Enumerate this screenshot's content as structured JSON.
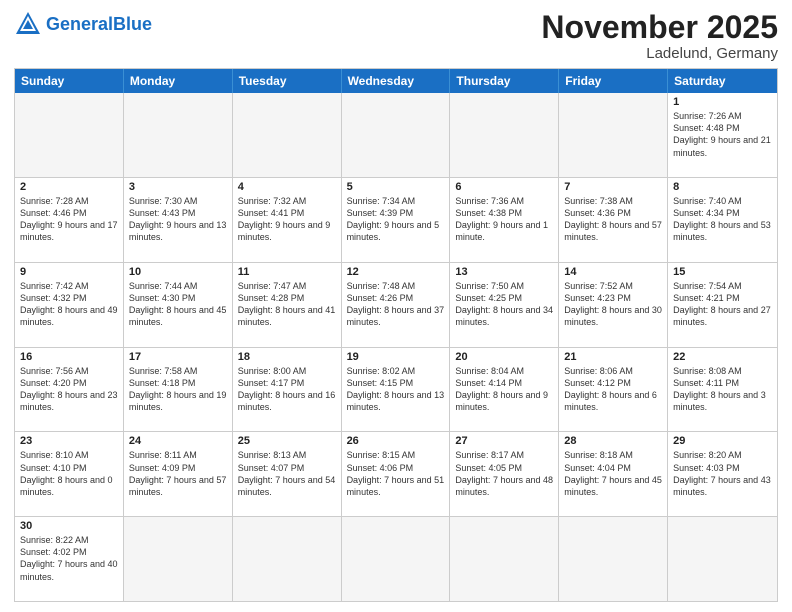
{
  "header": {
    "logo_general": "General",
    "logo_blue": "Blue",
    "month": "November 2025",
    "location": "Ladelund, Germany"
  },
  "days": [
    "Sunday",
    "Monday",
    "Tuesday",
    "Wednesday",
    "Thursday",
    "Friday",
    "Saturday"
  ],
  "rows": [
    [
      {
        "num": "",
        "empty": true
      },
      {
        "num": "",
        "empty": true
      },
      {
        "num": "",
        "empty": true
      },
      {
        "num": "",
        "empty": true
      },
      {
        "num": "",
        "empty": true
      },
      {
        "num": "",
        "empty": true
      },
      {
        "num": "1",
        "sunrise": "Sunrise: 7:26 AM",
        "sunset": "Sunset: 4:48 PM",
        "daylight": "Daylight: 9 hours and 21 minutes."
      }
    ],
    [
      {
        "num": "2",
        "sunrise": "Sunrise: 7:28 AM",
        "sunset": "Sunset: 4:46 PM",
        "daylight": "Daylight: 9 hours and 17 minutes."
      },
      {
        "num": "3",
        "sunrise": "Sunrise: 7:30 AM",
        "sunset": "Sunset: 4:43 PM",
        "daylight": "Daylight: 9 hours and 13 minutes."
      },
      {
        "num": "4",
        "sunrise": "Sunrise: 7:32 AM",
        "sunset": "Sunset: 4:41 PM",
        "daylight": "Daylight: 9 hours and 9 minutes."
      },
      {
        "num": "5",
        "sunrise": "Sunrise: 7:34 AM",
        "sunset": "Sunset: 4:39 PM",
        "daylight": "Daylight: 9 hours and 5 minutes."
      },
      {
        "num": "6",
        "sunrise": "Sunrise: 7:36 AM",
        "sunset": "Sunset: 4:38 PM",
        "daylight": "Daylight: 9 hours and 1 minute."
      },
      {
        "num": "7",
        "sunrise": "Sunrise: 7:38 AM",
        "sunset": "Sunset: 4:36 PM",
        "daylight": "Daylight: 8 hours and 57 minutes."
      },
      {
        "num": "8",
        "sunrise": "Sunrise: 7:40 AM",
        "sunset": "Sunset: 4:34 PM",
        "daylight": "Daylight: 8 hours and 53 minutes."
      }
    ],
    [
      {
        "num": "9",
        "sunrise": "Sunrise: 7:42 AM",
        "sunset": "Sunset: 4:32 PM",
        "daylight": "Daylight: 8 hours and 49 minutes."
      },
      {
        "num": "10",
        "sunrise": "Sunrise: 7:44 AM",
        "sunset": "Sunset: 4:30 PM",
        "daylight": "Daylight: 8 hours and 45 minutes."
      },
      {
        "num": "11",
        "sunrise": "Sunrise: 7:47 AM",
        "sunset": "Sunset: 4:28 PM",
        "daylight": "Daylight: 8 hours and 41 minutes."
      },
      {
        "num": "12",
        "sunrise": "Sunrise: 7:48 AM",
        "sunset": "Sunset: 4:26 PM",
        "daylight": "Daylight: 8 hours and 37 minutes."
      },
      {
        "num": "13",
        "sunrise": "Sunrise: 7:50 AM",
        "sunset": "Sunset: 4:25 PM",
        "daylight": "Daylight: 8 hours and 34 minutes."
      },
      {
        "num": "14",
        "sunrise": "Sunrise: 7:52 AM",
        "sunset": "Sunset: 4:23 PM",
        "daylight": "Daylight: 8 hours and 30 minutes."
      },
      {
        "num": "15",
        "sunrise": "Sunrise: 7:54 AM",
        "sunset": "Sunset: 4:21 PM",
        "daylight": "Daylight: 8 hours and 27 minutes."
      }
    ],
    [
      {
        "num": "16",
        "sunrise": "Sunrise: 7:56 AM",
        "sunset": "Sunset: 4:20 PM",
        "daylight": "Daylight: 8 hours and 23 minutes."
      },
      {
        "num": "17",
        "sunrise": "Sunrise: 7:58 AM",
        "sunset": "Sunset: 4:18 PM",
        "daylight": "Daylight: 8 hours and 19 minutes."
      },
      {
        "num": "18",
        "sunrise": "Sunrise: 8:00 AM",
        "sunset": "Sunset: 4:17 PM",
        "daylight": "Daylight: 8 hours and 16 minutes."
      },
      {
        "num": "19",
        "sunrise": "Sunrise: 8:02 AM",
        "sunset": "Sunset: 4:15 PM",
        "daylight": "Daylight: 8 hours and 13 minutes."
      },
      {
        "num": "20",
        "sunrise": "Sunrise: 8:04 AM",
        "sunset": "Sunset: 4:14 PM",
        "daylight": "Daylight: 8 hours and 9 minutes."
      },
      {
        "num": "21",
        "sunrise": "Sunrise: 8:06 AM",
        "sunset": "Sunset: 4:12 PM",
        "daylight": "Daylight: 8 hours and 6 minutes."
      },
      {
        "num": "22",
        "sunrise": "Sunrise: 8:08 AM",
        "sunset": "Sunset: 4:11 PM",
        "daylight": "Daylight: 8 hours and 3 minutes."
      }
    ],
    [
      {
        "num": "23",
        "sunrise": "Sunrise: 8:10 AM",
        "sunset": "Sunset: 4:10 PM",
        "daylight": "Daylight: 8 hours and 0 minutes."
      },
      {
        "num": "24",
        "sunrise": "Sunrise: 8:11 AM",
        "sunset": "Sunset: 4:09 PM",
        "daylight": "Daylight: 7 hours and 57 minutes."
      },
      {
        "num": "25",
        "sunrise": "Sunrise: 8:13 AM",
        "sunset": "Sunset: 4:07 PM",
        "daylight": "Daylight: 7 hours and 54 minutes."
      },
      {
        "num": "26",
        "sunrise": "Sunrise: 8:15 AM",
        "sunset": "Sunset: 4:06 PM",
        "daylight": "Daylight: 7 hours and 51 minutes."
      },
      {
        "num": "27",
        "sunrise": "Sunrise: 8:17 AM",
        "sunset": "Sunset: 4:05 PM",
        "daylight": "Daylight: 7 hours and 48 minutes."
      },
      {
        "num": "28",
        "sunrise": "Sunrise: 8:18 AM",
        "sunset": "Sunset: 4:04 PM",
        "daylight": "Daylight: 7 hours and 45 minutes."
      },
      {
        "num": "29",
        "sunrise": "Sunrise: 8:20 AM",
        "sunset": "Sunset: 4:03 PM",
        "daylight": "Daylight: 7 hours and 43 minutes."
      }
    ],
    [
      {
        "num": "30",
        "sunrise": "Sunrise: 8:22 AM",
        "sunset": "Sunset: 4:02 PM",
        "daylight": "Daylight: 7 hours and 40 minutes."
      },
      {
        "num": "",
        "empty": true
      },
      {
        "num": "",
        "empty": true
      },
      {
        "num": "",
        "empty": true
      },
      {
        "num": "",
        "empty": true
      },
      {
        "num": "",
        "empty": true
      },
      {
        "num": "",
        "empty": true
      }
    ]
  ]
}
